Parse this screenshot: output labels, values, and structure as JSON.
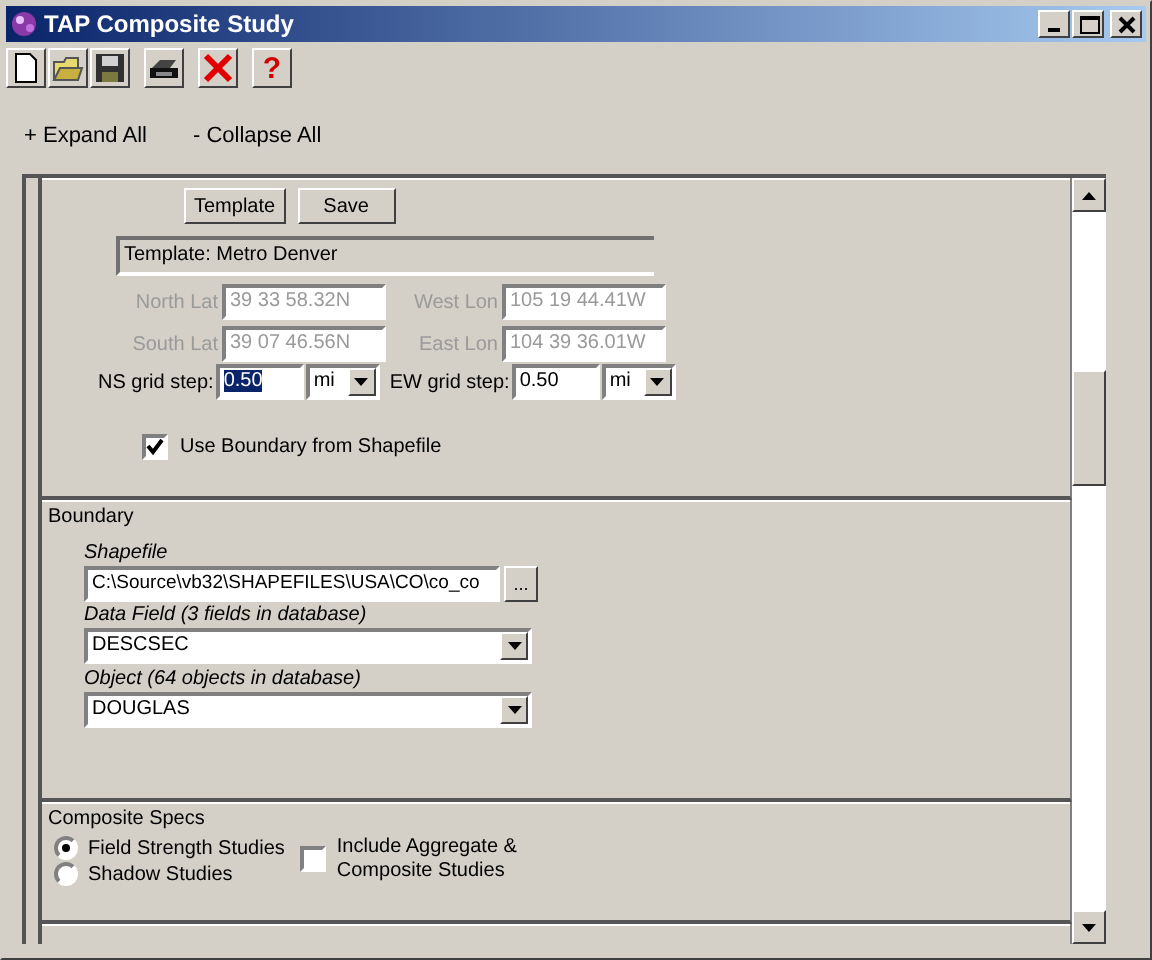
{
  "window": {
    "title": "TAP Composite Study"
  },
  "toolbar": [
    {
      "kind": "new"
    },
    {
      "kind": "open"
    },
    {
      "kind": "save"
    },
    {
      "kind": "print"
    },
    {
      "kind": "delete"
    },
    {
      "kind": "help",
      "glyph": "?"
    }
  ],
  "links": [
    "+ Expand All",
    "- Collapse All"
  ],
  "area_section": {
    "buttons": [
      "Template",
      "Save"
    ],
    "template_label": "Template: Metro Denver",
    "coords": [
      {
        "label": "North Lat",
        "value": "39 33 58.32N",
        "disabled": true
      },
      {
        "label": "West Lon",
        "value": "105 19 44.41W",
        "disabled": true
      },
      {
        "label": "South Lat",
        "value": "39 07 46.56N",
        "disabled": true
      },
      {
        "label": "East Lon",
        "value": "104 39 36.01W",
        "disabled": true
      }
    ],
    "grid_steps": [
      {
        "label": "NS grid step:",
        "value": "0.50",
        "unit": "mi",
        "highlighted": true
      },
      {
        "label": "EW grid step:",
        "value": "0.50",
        "unit": "mi",
        "highlighted": false
      }
    ],
    "use_boundary": {
      "label": "Use Boundary from Shapefile",
      "checked": true
    }
  },
  "boundary": {
    "title": "Boundary",
    "shapefile": {
      "label": "Shapefile",
      "value": "C:\\Source\\vb32\\SHAPEFILES\\USA\\CO\\co_co",
      "browse": "..."
    },
    "data_field": {
      "label": "Data Field (3 fields in database)",
      "value": "DESCSEC"
    },
    "object": {
      "label": "Object (64 objects in database)",
      "value": "DOUGLAS"
    }
  },
  "composite_specs": {
    "title": "Composite Specs",
    "study_types": [
      {
        "label": "Field Strength Studies",
        "selected": true
      },
      {
        "label": "Shadow Studies",
        "selected": false
      }
    ],
    "include_aggregate": {
      "label": "Include Aggregate & Composite Studies",
      "checked": false
    }
  }
}
